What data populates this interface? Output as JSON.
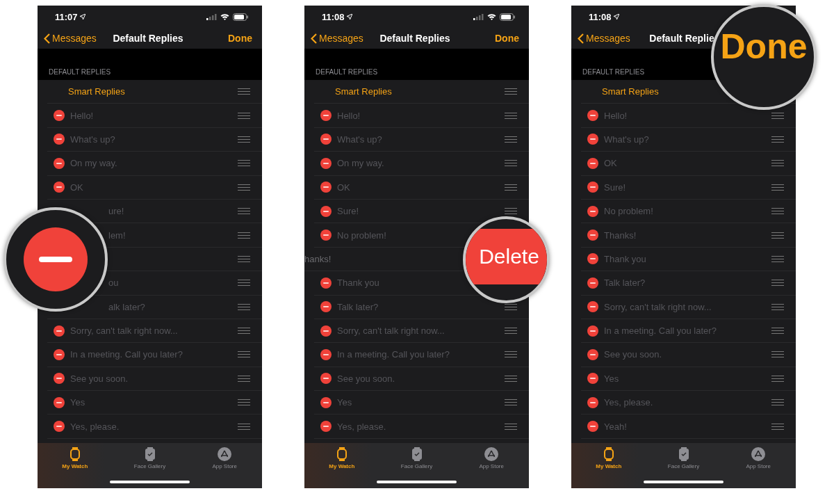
{
  "phones": [
    {
      "time": "11:07",
      "back": "Messages",
      "title": "Default Replies",
      "done": "Done",
      "section": "DEFAULT REPLIES",
      "rows": [
        {
          "kind": "smart",
          "text": "Smart Replies"
        },
        {
          "kind": "reply",
          "text": "Hello!",
          "covered": false
        },
        {
          "kind": "reply",
          "text": "What's up?",
          "covered": false
        },
        {
          "kind": "reply",
          "text": "On my way.",
          "covered": false
        },
        {
          "kind": "reply",
          "text": "OK",
          "covered": false
        },
        {
          "kind": "reply",
          "text": "ure!",
          "covered": true
        },
        {
          "kind": "reply",
          "text": "lem!",
          "covered": true
        },
        {
          "kind": "reply"
        },
        {
          "kind": "reply",
          "text": "ou",
          "covered": true
        },
        {
          "kind": "reply",
          "text": "alk later?",
          "covered": true
        },
        {
          "kind": "reply",
          "text": "Sorry, can't talk right now...",
          "covered": false
        },
        {
          "kind": "reply",
          "text": "In a meeting. Call you later?",
          "covered": false
        },
        {
          "kind": "reply",
          "text": "See you soon.",
          "covered": false
        },
        {
          "kind": "reply",
          "text": "Yes",
          "covered": false
        },
        {
          "kind": "reply",
          "text": "Yes, please.",
          "covered": false
        }
      ],
      "tabs": [
        {
          "label": "My Watch",
          "selected": true
        },
        {
          "label": "Face Gallery",
          "selected": false
        },
        {
          "label": "App Store",
          "selected": false
        }
      ],
      "magnifier": {
        "kind": "minus"
      }
    },
    {
      "time": "11:08",
      "back": "Messages",
      "title": "Default Replies",
      "done": "Done",
      "section": "DEFAULT REPLIES",
      "rows": [
        {
          "kind": "smart",
          "text": "Smart Replies"
        },
        {
          "kind": "reply",
          "text": "Hello!",
          "covered": false
        },
        {
          "kind": "reply",
          "text": "What's up?",
          "covered": false
        },
        {
          "kind": "reply",
          "text": "On my way.",
          "covered": false
        },
        {
          "kind": "reply",
          "text": "OK",
          "covered": false
        },
        {
          "kind": "reply",
          "text": "Sure!",
          "covered": false
        },
        {
          "kind": "reply",
          "text": "No problem!",
          "covered": false
        },
        {
          "kind": "swiped",
          "text": "hanks!"
        },
        {
          "kind": "reply",
          "text": "Thank you",
          "covered": false
        },
        {
          "kind": "reply",
          "text": "Talk later?",
          "covered": false
        },
        {
          "kind": "reply",
          "text": "Sorry, can't talk right now...",
          "covered": false
        },
        {
          "kind": "reply",
          "text": "In a meeting. Call you later?",
          "covered": false
        },
        {
          "kind": "reply",
          "text": "See you soon.",
          "covered": false
        },
        {
          "kind": "reply",
          "text": "Yes",
          "covered": false
        },
        {
          "kind": "reply",
          "text": "Yes, please.",
          "covered": false
        }
      ],
      "tabs": [
        {
          "label": "My Watch",
          "selected": true
        },
        {
          "label": "Face Gallery",
          "selected": false
        },
        {
          "label": "App Store",
          "selected": false
        }
      ],
      "magnifier": {
        "kind": "delete",
        "text": "Delete"
      }
    },
    {
      "time": "11:08",
      "back": "Messages",
      "title": "Default Replie",
      "section": "DEFAULT REPLIES",
      "rows": [
        {
          "kind": "smart",
          "text": "Smart Replies"
        },
        {
          "kind": "reply",
          "text": "Hello!",
          "covered": false
        },
        {
          "kind": "reply",
          "text": "What's up?",
          "covered": false
        },
        {
          "kind": "reply",
          "text": "OK",
          "covered": false
        },
        {
          "kind": "reply",
          "text": "Sure!",
          "covered": false
        },
        {
          "kind": "reply",
          "text": "No problem!",
          "covered": false
        },
        {
          "kind": "reply",
          "text": "Thanks!",
          "covered": false
        },
        {
          "kind": "reply",
          "text": "Thank you",
          "covered": false
        },
        {
          "kind": "reply",
          "text": "Talk later?",
          "covered": false
        },
        {
          "kind": "reply",
          "text": "Sorry, can't talk right now...",
          "covered": false
        },
        {
          "kind": "reply",
          "text": "In a meeting. Call you later?",
          "covered": false
        },
        {
          "kind": "reply",
          "text": "See you soon.",
          "covered": false
        },
        {
          "kind": "reply",
          "text": "Yes",
          "covered": false
        },
        {
          "kind": "reply",
          "text": "Yes, please.",
          "covered": false
        },
        {
          "kind": "reply",
          "text": "Yeah!",
          "covered": false
        }
      ],
      "tabs": [
        {
          "label": "My Watch",
          "selected": true
        },
        {
          "label": "Face Gallery",
          "selected": false
        },
        {
          "label": "App Store",
          "selected": false
        }
      ],
      "magnifier": {
        "kind": "done",
        "text": "Done"
      }
    }
  ]
}
